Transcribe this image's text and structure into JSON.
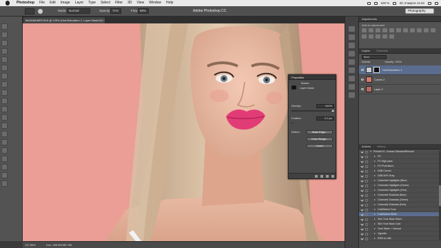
{
  "menubar": {
    "items": [
      "Photoshop",
      "File",
      "Edit",
      "Image",
      "Layer",
      "Type",
      "Select",
      "Filter",
      "3D",
      "View",
      "Window",
      "Help"
    ],
    "battery": "100 %",
    "datetime": "Вт, 8 марта 14:42"
  },
  "optionsbar": {
    "app_title": "Adobe Photoshop CC",
    "mode_label": "Mode:",
    "mode_value": "Normal",
    "opacity_label": "Opacity:",
    "opacity_value": "71%",
    "flow_label": "Flow:",
    "flow_value": "89%",
    "workspace": "Photography"
  },
  "document": {
    "tab_title": "BASAMHMRC2KII @ 129% (Hue/Saturation 1, Layer Mask/16) *",
    "zoom": "127.86%",
    "doc_info": "Doc: 185.9M/387.9M",
    "canvas_color": "#ea9e95"
  },
  "properties": {
    "tab": "Properties",
    "section": "Masks",
    "mask_label": "Layer Mask",
    "density_label": "Density:",
    "density_value": "100%",
    "feather_label": "Feather:",
    "feather_value": "0.0 px",
    "refine_label": "Refine:",
    "buttons": [
      "Mask Edge...",
      "Color Range...",
      "Invert"
    ]
  },
  "adjustments": {
    "tab": "Adjustments",
    "title": "Add an adjustment"
  },
  "layers": {
    "tabs": [
      "Layers",
      "Channels"
    ],
    "filter": "Kind",
    "blend": "Normal",
    "opacity": "Opacity: 100%",
    "fill": "Fill: 100%",
    "lock": "Lock:",
    "items": [
      {
        "name": "Hue/Saturation 1",
        "color": "#c9c9c9",
        "active": true
      },
      {
        "name": "Curves 2",
        "color": "#d07a6d",
        "active": false
      },
      {
        "name": "Layer 0",
        "color": "#b56b62",
        "active": false
      }
    ]
  },
  "actions": {
    "tabs": [
      "Actions",
      "History"
    ],
    "items": [
      {
        "label": "Portrait 01. Скачка StandardRetouch",
        "level": 0,
        "open": true,
        "sel": false
      },
      {
        "label": "FS",
        "level": 1,
        "open": false,
        "sel": false
      },
      {
        "label": "FS High pass",
        "level": 1,
        "open": false,
        "sel": false
      },
      {
        "label": "FS+Portraiture",
        "level": 1,
        "open": false,
        "sel": false
      },
      {
        "label": "D&B Curves",
        "level": 1,
        "open": false,
        "sel": false
      },
      {
        "label": "D&B 50% Gray",
        "level": 1,
        "open": false,
        "sel": false
      },
      {
        "label": "Channels Highlights (Blue)",
        "level": 1,
        "open": false,
        "sel": false
      },
      {
        "label": "Channels Highlights (Green)",
        "level": 1,
        "open": false,
        "sel": false
      },
      {
        "label": "Channels Highlights (Red)",
        "level": 1,
        "open": false,
        "sel": false
      },
      {
        "label": "Channels Shadows (Blue)",
        "level": 1,
        "open": false,
        "sel": false
      },
      {
        "label": "Channels Shadows (Green)",
        "level": 1,
        "open": false,
        "sel": false
      },
      {
        "label": "Channels Shadows (Red)",
        "level": 1,
        "open": false,
        "sel": false
      },
      {
        "label": "Cold/Warm Tone",
        "level": 1,
        "open": false,
        "sel": false
      },
      {
        "label": "Cold/Warm White",
        "level": 1,
        "open": false,
        "sel": true
      },
      {
        "label": "Skin Tone Base Warm",
        "level": 1,
        "open": false,
        "sel": false
      },
      {
        "label": "Skin Tone Base Cold",
        "level": 1,
        "open": false,
        "sel": false
      },
      {
        "label": "Tone Warm + Normal",
        "level": 1,
        "open": false,
        "sel": false
      },
      {
        "label": "Vignette",
        "level": 1,
        "open": false,
        "sel": false
      },
      {
        "label": "RGB to LAB",
        "level": 1,
        "open": false,
        "sel": false
      }
    ]
  }
}
